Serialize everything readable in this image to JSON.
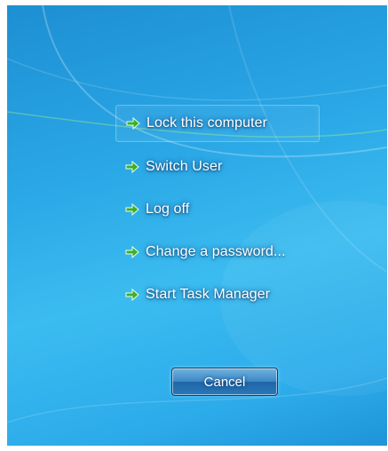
{
  "menu": {
    "options": [
      {
        "label": "Lock this computer",
        "icon": "green-arrow-icon"
      },
      {
        "label": "Switch User",
        "icon": "green-arrow-icon"
      },
      {
        "label": "Log off",
        "icon": "green-arrow-icon"
      },
      {
        "label": "Change a password...",
        "icon": "green-arrow-icon"
      },
      {
        "label": "Start Task Manager",
        "icon": "green-arrow-icon"
      }
    ],
    "focused_index": 0
  },
  "cancel": {
    "label": "Cancel"
  },
  "colors": {
    "background": "#2aa7e6",
    "arrow": "#3fae2a",
    "text": "#ffffff"
  }
}
